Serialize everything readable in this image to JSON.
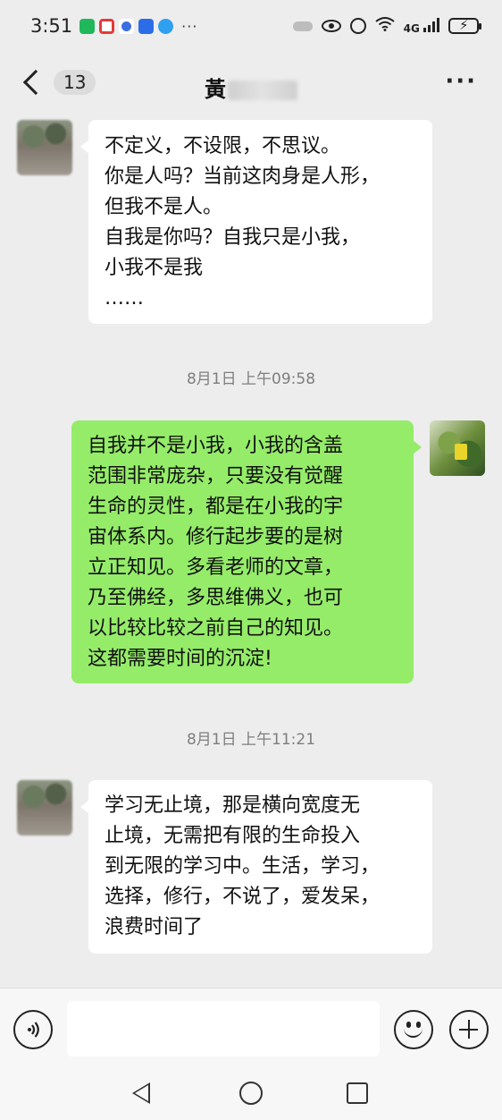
{
  "status_bar": {
    "time": "3:51",
    "more": "···",
    "network": "4G"
  },
  "header": {
    "unread_count": "13",
    "title": "黃",
    "menu": "···"
  },
  "messages": [
    {
      "side": "received",
      "lines": [
        "不定义，不设限，不思议。",
        "你是人吗？当前这肉身是人形，",
        "但我不是人。",
        "自我是你吗？自我只是小我，",
        "小我不是我",
        "……"
      ]
    },
    {
      "side": "sent",
      "lines": [
        "自我并不是小我，小我的含盖",
        "范围非常庞杂，只要没有觉醒",
        "生命的灵性，都是在小我的宇",
        "宙体系内。修行起步要的是树",
        "立正知见。多看老师的文章，",
        "乃至佛经，多思维佛义，也可",
        "以比较比较之前自己的知见。",
        "这都需要时间的沉淀!"
      ]
    },
    {
      "side": "received",
      "lines": [
        "学习无止境，那是横向宽度无",
        "止境，无需把有限的生命投入",
        "到无限的学习中。生活，学习，",
        "选择，修行，不说了，爱发呆，",
        "浪费时间了"
      ]
    }
  ],
  "timestamps": [
    "8月1日 上午09:58",
    "8月1日 上午11:21"
  ],
  "input_bar": {
    "voice_icon": "voice-icon",
    "emoji_icon": "emoji-icon",
    "plus_icon": "plus-icon"
  },
  "colors": {
    "background": "#ededed",
    "sent_bubble": "#95ec69",
    "received_bubble": "#ffffff"
  }
}
